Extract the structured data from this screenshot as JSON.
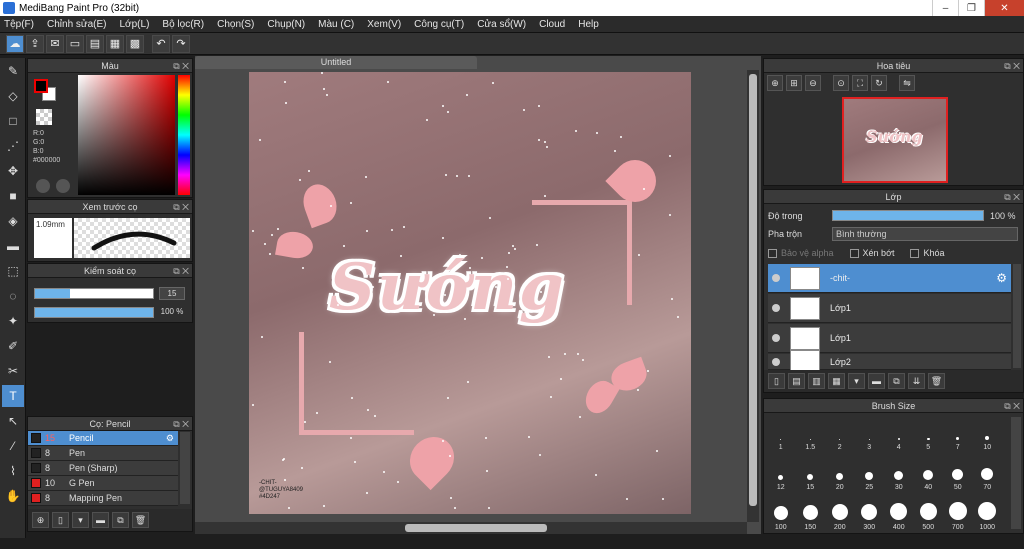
{
  "window": {
    "title": "MediBang Paint Pro (32bit)",
    "min_glyph": "–",
    "max_glyph": "❐",
    "close_glyph": "✕"
  },
  "menu": [
    "Tệp(F)",
    "Chỉnh sửa(E)",
    "Lớp(L)",
    "Bộ lọc(R)",
    "Chọn(S)",
    "Chụp(N)",
    "Màu (C)",
    "Xem(V)",
    "Công cụ(T)",
    "Cửa sổ(W)",
    "Cloud",
    "Help"
  ],
  "color_panel": {
    "title": "Màu",
    "r": "R:0",
    "g": "G:0",
    "b": "B:0",
    "hex": "#000000"
  },
  "preview_panel": {
    "title": "Xem trước cọ",
    "size": "1.09mm"
  },
  "control_panel": {
    "title": "Kiểm soát cọ",
    "size_value": "15",
    "size_fraction": 0.3,
    "opacity_value": "100 %",
    "opacity_fraction": 1.0
  },
  "brush_panel": {
    "title": "Cọ: Pencil",
    "brushes": [
      {
        "size": "15",
        "name": "Pencil",
        "selected": true,
        "red": false
      },
      {
        "size": "8",
        "name": "Pen",
        "selected": false,
        "red": false
      },
      {
        "size": "8",
        "name": "Pen (Sharp)",
        "selected": false,
        "red": false
      },
      {
        "size": "10",
        "name": "G Pen",
        "selected": false,
        "red": true
      },
      {
        "size": "8",
        "name": "Mapping Pen",
        "selected": false,
        "red": true
      }
    ]
  },
  "document": {
    "tab": "Untitled",
    "art_title": "Sướng",
    "credit": [
      "-CHIT-",
      "@TUGUYA8409",
      "#4D247"
    ]
  },
  "navigator": {
    "title": "Hoa tiêu",
    "thumb_text": "Sướng"
  },
  "layer_panel": {
    "title": "Lớp",
    "opacity_label": "Độ trong",
    "opacity_value": "100 %",
    "opacity_fraction": 1.0,
    "blend_label": "Pha trộn",
    "blend_value": "Bình thường",
    "protect_alpha": "Bảo vệ alpha",
    "clip": "Xén bớt",
    "lock": "Khóa",
    "layers": [
      {
        "name": "-chit-",
        "selected": true
      },
      {
        "name": "Lớp1",
        "selected": false
      },
      {
        "name": "Lớp1",
        "selected": false
      },
      {
        "name": "Lớp2",
        "selected": false
      }
    ]
  },
  "brush_size_panel": {
    "title": "Brush Size",
    "sizes": [
      "1",
      "1.5",
      "2",
      "3",
      "4",
      "5",
      "7",
      "10",
      "12",
      "15",
      "20",
      "25",
      "30",
      "40",
      "50",
      "70",
      "100",
      "150",
      "200",
      "300",
      "400",
      "500",
      "700",
      "1000"
    ]
  },
  "icons": {
    "toolbar": [
      "brush-mode-icon",
      "export-icon",
      "chat-icon",
      "comment-icon",
      "page-icon",
      "panels-icon",
      "grid-icon",
      "undo-icon",
      "redo-icon"
    ],
    "tools": [
      "brush-icon",
      "eraser-icon",
      "rectangle-icon",
      "dot-icon",
      "move-icon",
      "fill-rect-icon",
      "bucket-icon",
      "gradient-icon",
      "select-rect-icon",
      "lasso-icon",
      "magic-wand-icon",
      "select-pen-icon",
      "select-eraser-icon",
      "text-icon",
      "operation-icon",
      "divide-icon",
      "eyedropper-icon",
      "hand-icon"
    ]
  }
}
